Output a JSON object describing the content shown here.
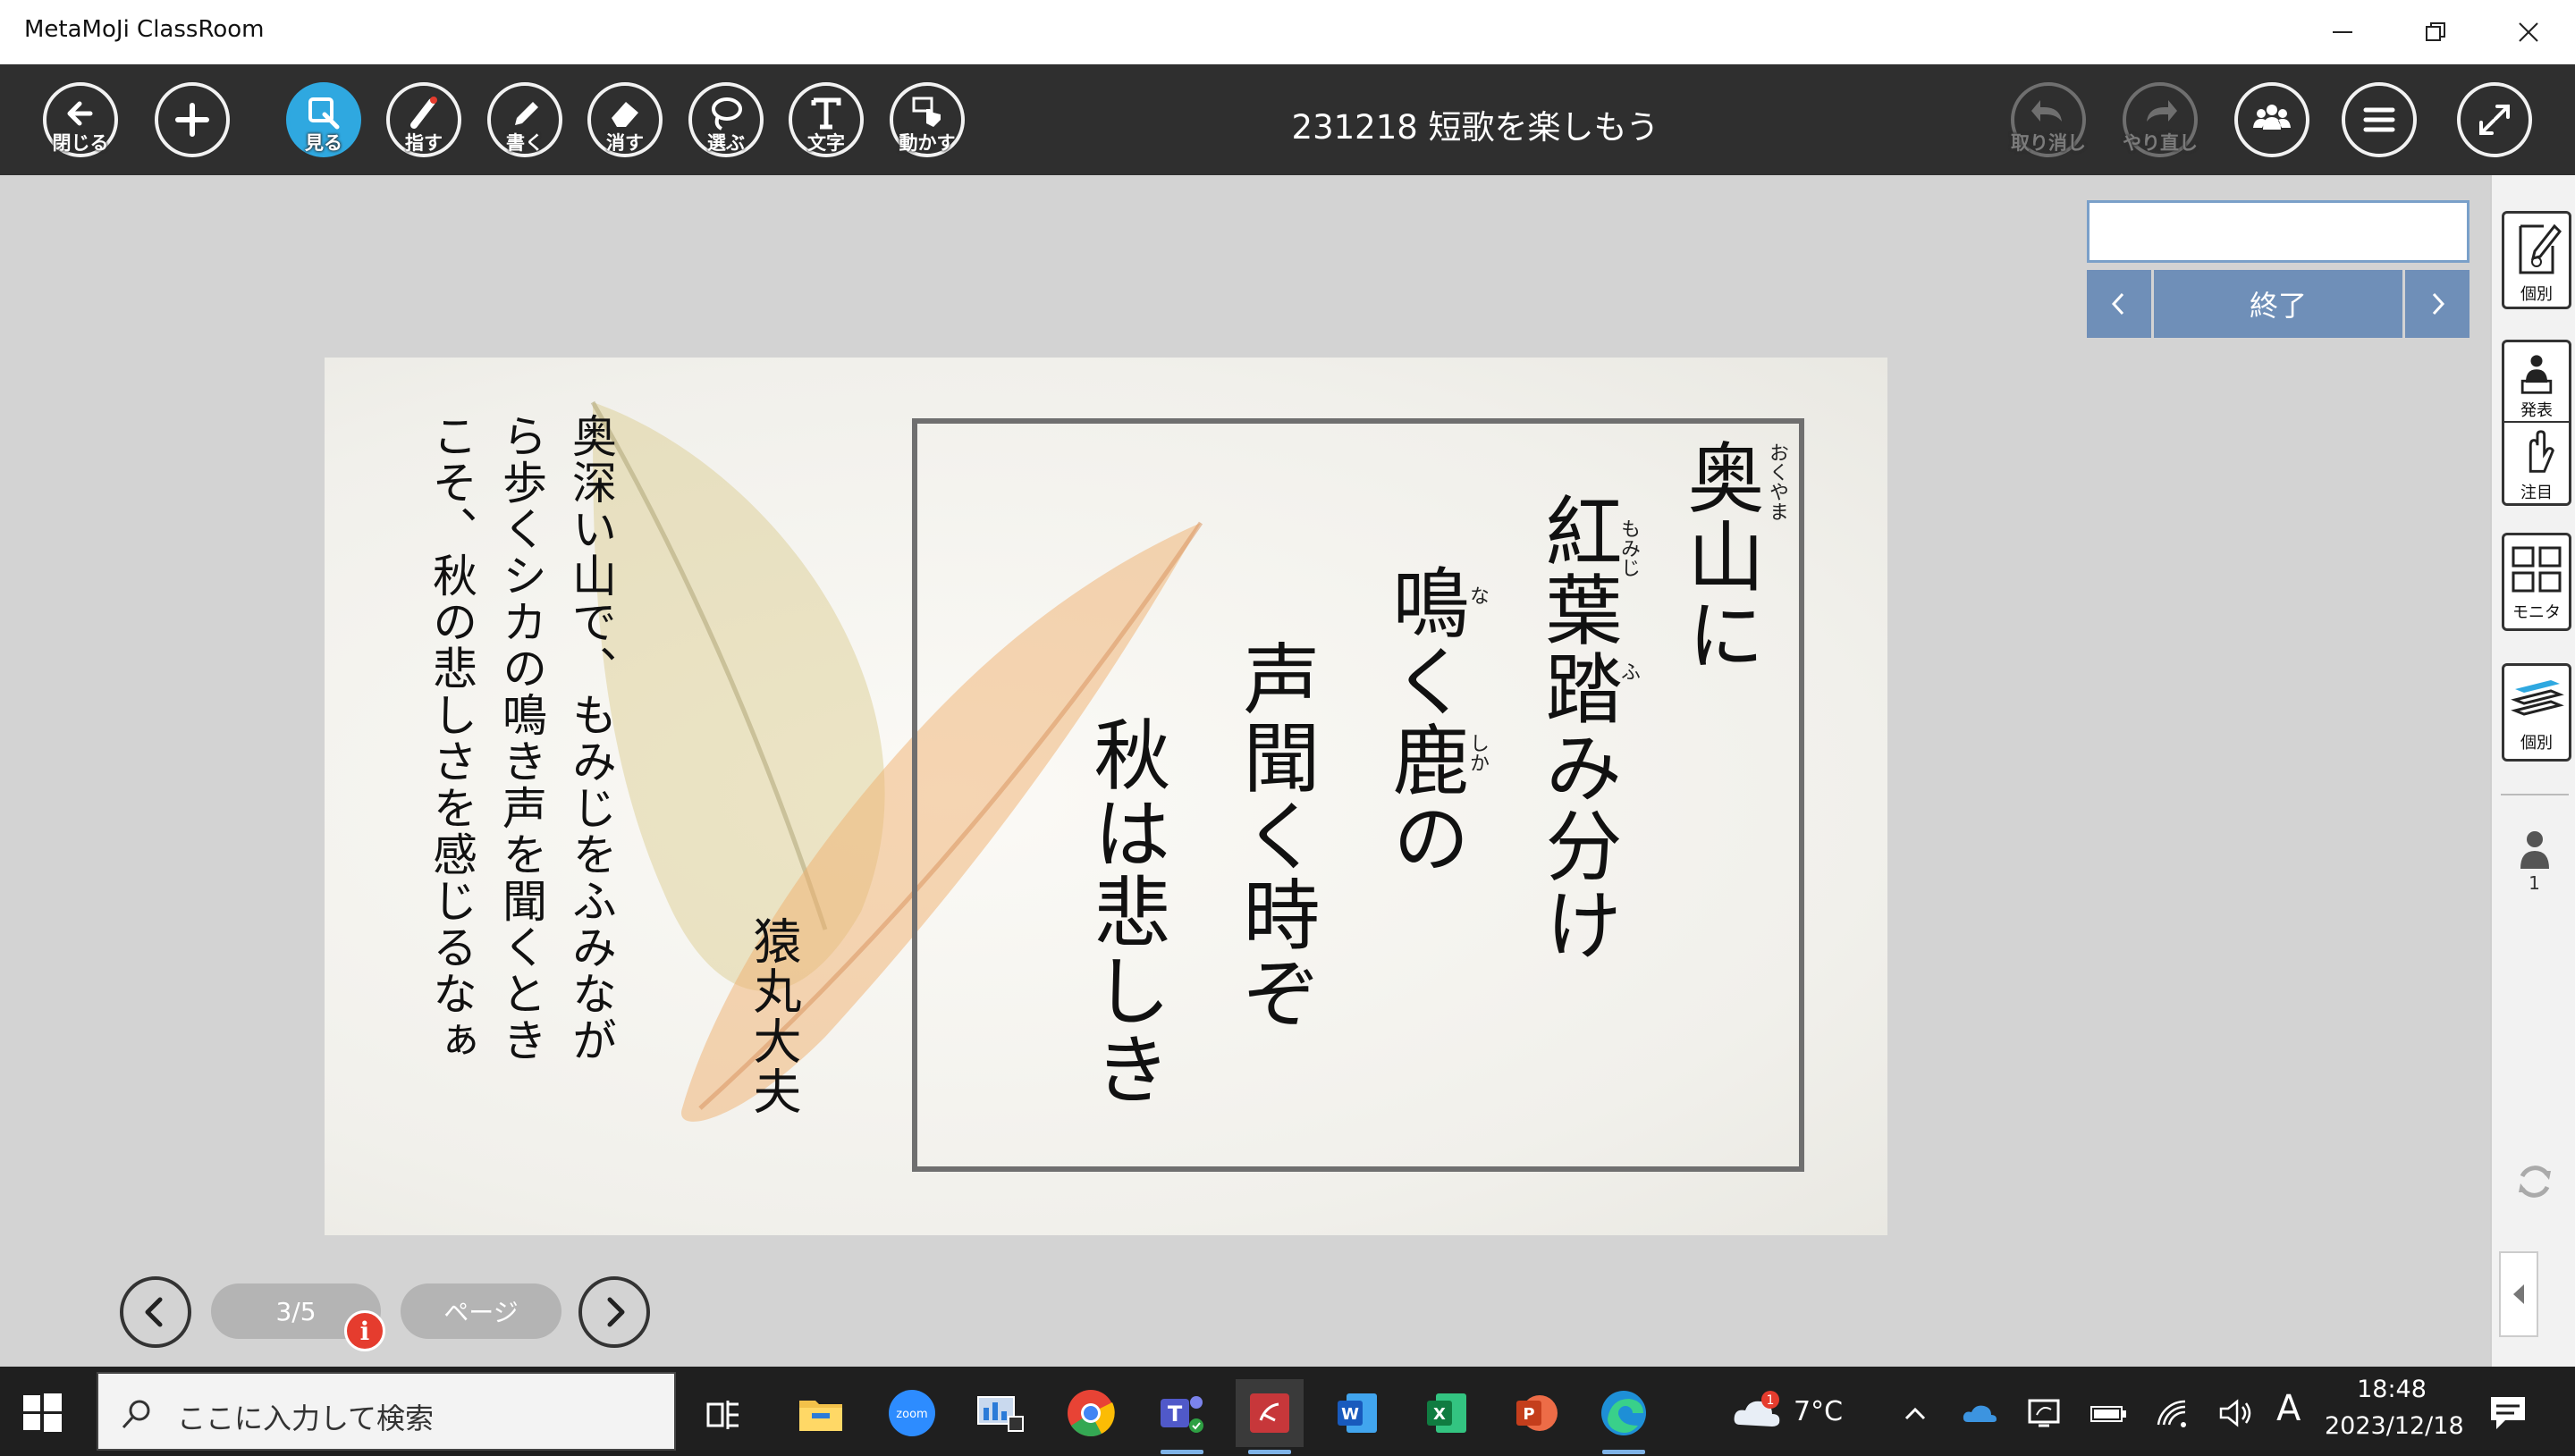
{
  "window": {
    "app_title": "MetaMoJi ClassRoom",
    "minimize_icon": "minimize-icon",
    "restore_icon": "restore-icon",
    "close_icon": "close-icon"
  },
  "toolbar": {
    "close_label": "閉じる",
    "add_icon": "plus-icon",
    "view_label": "見る",
    "point_label": "指す",
    "write_label": "書く",
    "erase_label": "消す",
    "select_label": "選ぶ",
    "text_label": "文字",
    "move_label": "動かす",
    "document_title": "231218 短歌を楽しもう",
    "undo_label": "取り消し",
    "redo_label": "やり直し",
    "users_icon": "group-icon",
    "menu_icon": "hamburger-menu-icon",
    "fullscreen_icon": "expand-icon"
  },
  "card": {
    "poem_lines": [
      "奥山に",
      "紅葉踏み分け",
      "鳴く鹿の",
      "声聞く時ぞ",
      "秋は悲しき"
    ],
    "ruby": {
      "okuyama": "おくやま",
      "momiji": "もみじ",
      "fu": "ふ",
      "na": "な",
      "shika": "しか"
    },
    "author": "猿丸大夫",
    "translation_lines": [
      "奥深い山で、もみじをふみなが",
      "ら歩くシカの鳴き声を聞くとき",
      "こそ、秋の悲しさを感じるなぁ"
    ]
  },
  "session_panel": {
    "input_value": "",
    "end_label": "終了"
  },
  "sidebar": {
    "individual_label": "個別",
    "present_label": "発表",
    "attention_label": "注目",
    "monitor_label": "モニタ",
    "individual2_label": "個別",
    "user_count": "1"
  },
  "page_nav": {
    "page_indicator": "3/5",
    "page_button_label": "ページ"
  },
  "taskbar": {
    "search_placeholder": "ここに入力して検索",
    "weather_badge": "1",
    "temperature": "7°C",
    "ime": "A",
    "time": "18:48",
    "date": "2023/12/18",
    "apps": [
      "task-view-icon",
      "file-explorer-icon",
      "zoom-icon",
      "monitor-app-icon",
      "chrome-icon",
      "teams-icon",
      "metamoji-icon",
      "word-icon",
      "excel-icon",
      "powerpoint-icon",
      "edge-icon"
    ]
  },
  "colors": {
    "toolbar_bg": "#2f2f2f",
    "active_tool": "#2fa8e0",
    "workspace_bg": "#d3d3d3",
    "panel_blue": "#6f8fb8",
    "taskbar_bg": "#1f1f1f",
    "badge_red": "#e53c2e"
  }
}
